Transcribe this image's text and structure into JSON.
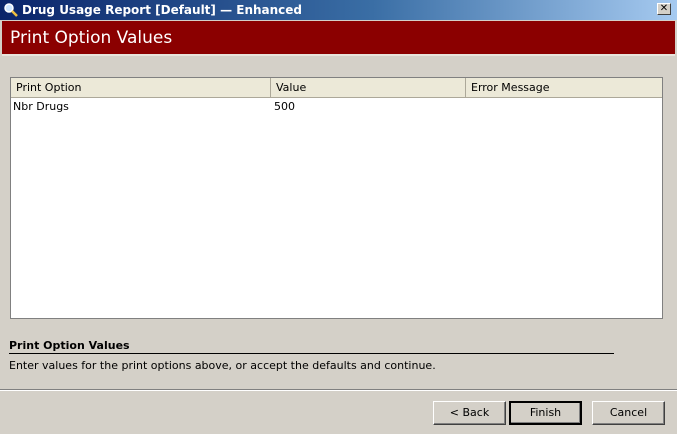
{
  "window": {
    "title": "Drug Usage Report [Default] — Enhanced",
    "close_glyph": "✕"
  },
  "banner": {
    "title": "Print Option Values"
  },
  "grid": {
    "columns": [
      "Print Option",
      "Value",
      "Error Message"
    ],
    "rows": [
      {
        "option": "Nbr Drugs",
        "value": "500",
        "error": ""
      }
    ]
  },
  "info": {
    "title": "Print Option Values",
    "text": "Enter values for the print options above, or accept the defaults and continue."
  },
  "buttons": {
    "back": "< Back",
    "finish": "Finish",
    "cancel": "Cancel"
  },
  "colors": {
    "banner": "#8b0000",
    "titlebar": "#0a246a",
    "face": "#d4d0c8"
  }
}
